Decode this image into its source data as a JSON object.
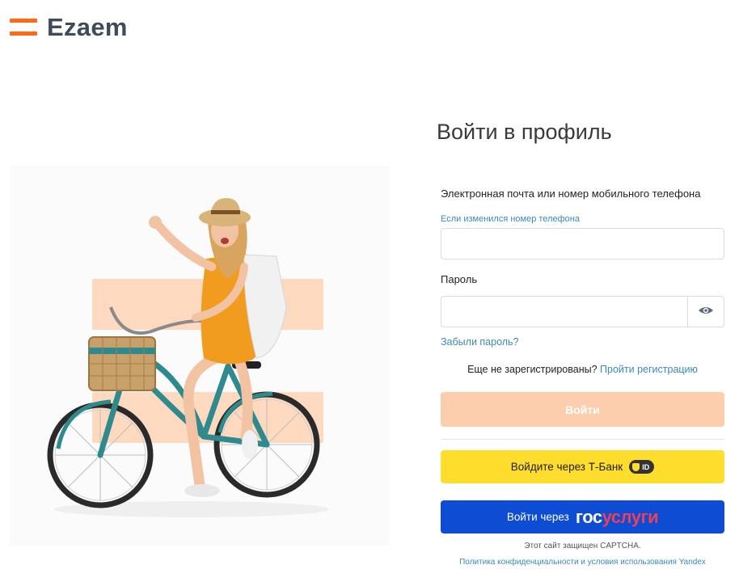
{
  "logo": {
    "text": "Ezaem"
  },
  "form": {
    "title": "Войти в профиль",
    "email_label": "Электронная почта или номер мобильного телефона",
    "phone_changed_link": "Если изменился номер телефона",
    "email_value": "",
    "password_label": "Пароль",
    "password_value": "",
    "forgot_link": "Забыли пароль?",
    "not_registered_text": "Еще не зарегистрированы?",
    "register_link": "Пройти регистрацию",
    "login_button": "Войти"
  },
  "social": {
    "tbank_label": "Войдите через Т-Банк",
    "tbank_badge": "ID",
    "gos_label": "Войти через",
    "gos_logo_part1": "гос",
    "gos_logo_part2": "услуги"
  },
  "footer": {
    "captcha_note": "Этот сайт защищен CAPTCHA.",
    "yandex_link": "Политика конфиденциальности и условия использования Yandex"
  },
  "icons": {
    "logo_mark": "ezaem-logo-icon",
    "password_toggle": "eye-icon",
    "tbank_shield": "shield-icon"
  },
  "colors": {
    "brand_orange": "#ff6a13",
    "login_button_disabled": "#fdceae",
    "link_blue": "#3c89b8",
    "tbank_yellow": "#ffdd2d",
    "gosuslugi_blue": "#0d4cd3",
    "gosuslugi_red": "#ee3f58"
  }
}
